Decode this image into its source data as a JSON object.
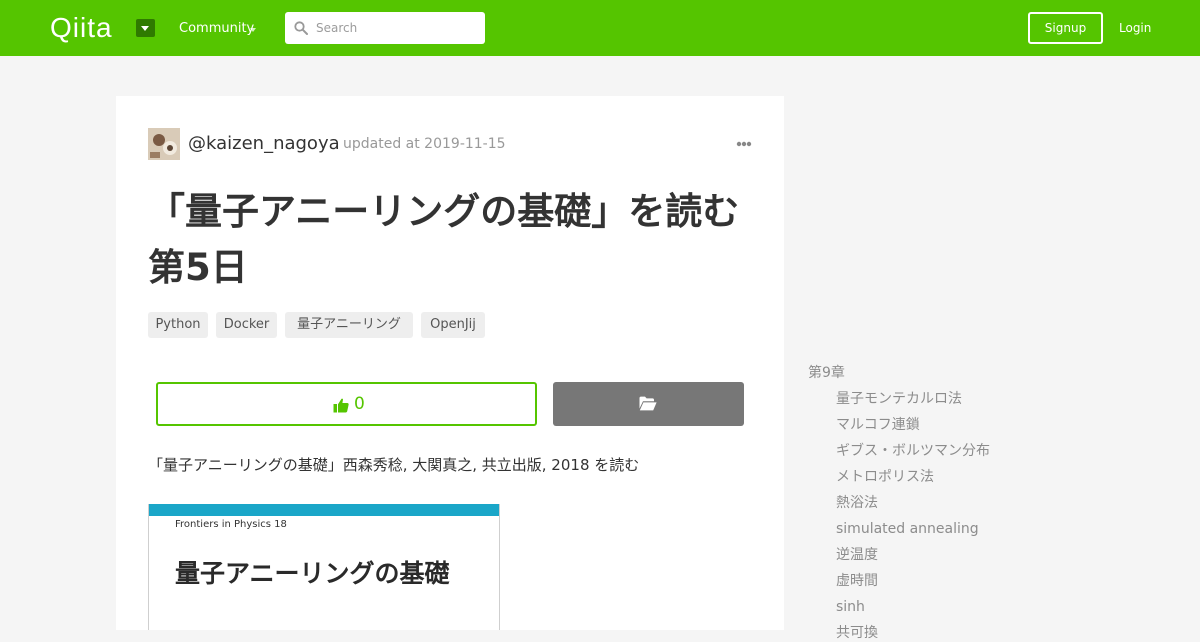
{
  "header": {
    "logo": "Qiita",
    "community_label": "Community",
    "search_placeholder": "Search",
    "signup_label": "Signup",
    "login_label": "Login",
    "brand_color": "#55c500"
  },
  "article": {
    "author": "@kaizen_nagoya",
    "updated": "updated at 2019-11-15",
    "title": "「量子アニーリングの基礎」を読む 第5日",
    "tags": [
      "Python",
      "Docker",
      "量子アニーリング",
      "OpenJij"
    ],
    "like_count": "0",
    "lead": "「量子アニーリングの基礎」西森秀稔, 大関真之, 共立出版, 2018 を読む",
    "book_cover": {
      "series": "Frontiers in Physics 18",
      "title": "量子アニーリングの基礎"
    }
  },
  "toc": {
    "chapter": "第9章",
    "items": [
      "量子モンテカルロ法",
      "マルコフ連鎖",
      "ギブス・ボルツマン分布",
      "メトロポリス法",
      "熱浴法",
      "simulated annealing",
      "逆温度",
      "虚時間",
      "sinh",
      "共可換"
    ]
  }
}
